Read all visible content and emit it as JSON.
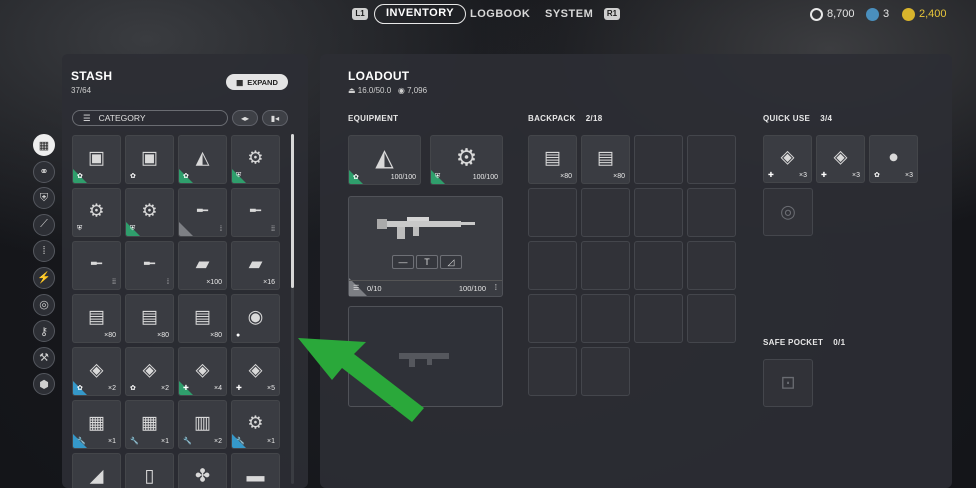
{
  "topbar": {
    "l1": "L1",
    "r1": "R1",
    "tabs": [
      {
        "label": "INVENTORY",
        "active": true
      },
      {
        "label": "LOGBOOK",
        "active": false
      },
      {
        "label": "SYSTEM",
        "active": false
      }
    ],
    "currencies": [
      {
        "icon": "coin-icon",
        "value": "8,700",
        "color": "#e8e8e8"
      },
      {
        "icon": "token-icon",
        "value": "3",
        "color": "#6fb7e0"
      },
      {
        "icon": "gold-icon",
        "value": "2,400",
        "color": "#e8c63a"
      }
    ]
  },
  "stash": {
    "title": "STASH",
    "count": "37/64",
    "expand_label": "EXPAND",
    "category_label": "CATEGORY",
    "side_icons": [
      "grid-icon",
      "link-icon",
      "shield-icon",
      "blade-icon",
      "ammo-icon",
      "bolt-icon",
      "ring-icon",
      "wrench-key-icon",
      "wrench-icon",
      "cube-icon"
    ],
    "items": [
      {
        "art": "▣",
        "corner": "green",
        "badge": "✿",
        "qty": ""
      },
      {
        "art": "▣",
        "corner": "",
        "badge": "✿",
        "qty": ""
      },
      {
        "art": "◭",
        "corner": "green",
        "badge": "✿",
        "qty": ""
      },
      {
        "art": "⚙",
        "corner": "green",
        "badge": "⛨",
        "qty": ""
      },
      {
        "art": "⚙",
        "corner": "",
        "badge": "⛨",
        "qty": ""
      },
      {
        "art": "⚙",
        "corner": "green",
        "badge": "⛨",
        "qty": ""
      },
      {
        "art": "╾",
        "corner": "gray",
        "badge": "",
        "qty": "⁞"
      },
      {
        "art": "╾",
        "corner": "",
        "badge": "",
        "qty": "⁞⁞"
      },
      {
        "art": "╾",
        "corner": "",
        "badge": "",
        "qty": "⁞⁞"
      },
      {
        "art": "╾",
        "corner": "",
        "badge": "",
        "qty": "⁞"
      },
      {
        "art": "▰",
        "corner": "",
        "badge": "",
        "qty": "×100"
      },
      {
        "art": "▰",
        "corner": "",
        "badge": "",
        "qty": "×16"
      },
      {
        "art": "▤",
        "corner": "",
        "badge": "",
        "qty": "×80"
      },
      {
        "art": "▤",
        "corner": "",
        "badge": "",
        "qty": "×80"
      },
      {
        "art": "▤",
        "corner": "",
        "badge": "",
        "qty": "×80"
      },
      {
        "art": "◉",
        "corner": "",
        "badge": "●",
        "qty": ""
      },
      {
        "art": "◈",
        "corner": "blue",
        "badge": "✿",
        "qty": "×2"
      },
      {
        "art": "◈",
        "corner": "",
        "badge": "✿",
        "qty": "×2"
      },
      {
        "art": "◈",
        "corner": "green",
        "badge": "✚",
        "qty": "×4"
      },
      {
        "art": "◈",
        "corner": "",
        "badge": "✚",
        "qty": "×5"
      },
      {
        "art": "▦",
        "corner": "blue",
        "badge": "🔧",
        "qty": "×1"
      },
      {
        "art": "▦",
        "corner": "",
        "badge": "🔧",
        "qty": "×1"
      },
      {
        "art": "▥",
        "corner": "",
        "badge": "🔧",
        "qty": "×2"
      },
      {
        "art": "⚙",
        "corner": "blue",
        "badge": "🔧",
        "qty": "×1"
      },
      {
        "art": "◢",
        "corner": "",
        "badge": "",
        "qty": ""
      },
      {
        "art": "▯",
        "corner": "",
        "badge": "",
        "qty": ""
      },
      {
        "art": "✤",
        "corner": "",
        "badge": "",
        "qty": ""
      },
      {
        "art": "▬",
        "corner": "",
        "badge": "",
        "qty": ""
      }
    ]
  },
  "loadout": {
    "title": "LOADOUT",
    "weight": "16.0/50.0",
    "value": "7,096",
    "equipment_label": "EQUIPMENT",
    "equipment": [
      {
        "art": "◭",
        "badge": "✿",
        "qty": "100/100"
      },
      {
        "art": "⚙",
        "badge": "⛨",
        "qty": "100/100"
      }
    ],
    "weapon": {
      "ammo": "0/10",
      "durability": "100/100",
      "attachments": [
        "—",
        "T",
        "◿"
      ]
    },
    "backpack_label": "BACKPACK",
    "backpack_count": "2/18",
    "backpack_items": [
      {
        "art": "▤",
        "qty": "×80"
      },
      {
        "art": "▤",
        "qty": "×80"
      }
    ],
    "quick_use_label": "QUICK USE",
    "quick_use_count": "3/4",
    "quick_use_items": [
      {
        "art": "◈",
        "badge": "✚",
        "qty": "×3"
      },
      {
        "art": "◈",
        "badge": "✚",
        "qty": "×3"
      },
      {
        "art": "●",
        "badge": "✿",
        "qty": "×3"
      }
    ],
    "safe_pocket_label": "SAFE POCKET",
    "safe_pocket_count": "0/1"
  }
}
